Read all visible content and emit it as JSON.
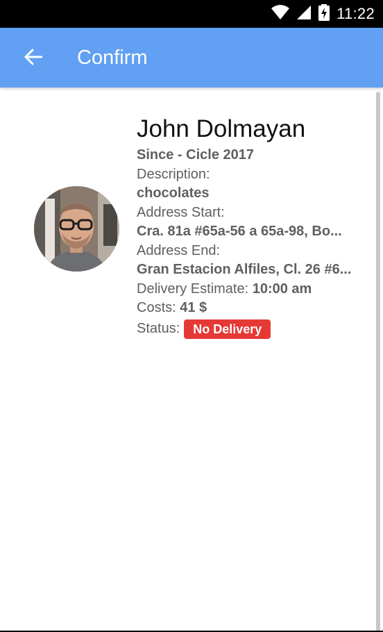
{
  "status_bar": {
    "time": "11:22"
  },
  "app_bar": {
    "title": "Confirm"
  },
  "profile": {
    "name": "John Dolmayan",
    "since": "Since - Cicle 2017",
    "description_label": "Description:",
    "description_value": "chocolates",
    "address_start_label": "Address Start:",
    "address_start_value": "Cra. 81a #65a-56 a 65a-98, Bo...",
    "address_end_label": "Address End:",
    "address_end_value": "Gran Estacion Alfiles, Cl. 26 #6...",
    "delivery_estimate_label": "Delivery Estimate: ",
    "delivery_estimate_value": "10:00 am",
    "costs_label": "Costs: ",
    "costs_value": "41 $",
    "status_label": "Status:",
    "status_value": "No Delivery"
  },
  "colors": {
    "app_bar": "#61a0f2",
    "status_badge": "#e53935",
    "status_bar": "#000000"
  }
}
